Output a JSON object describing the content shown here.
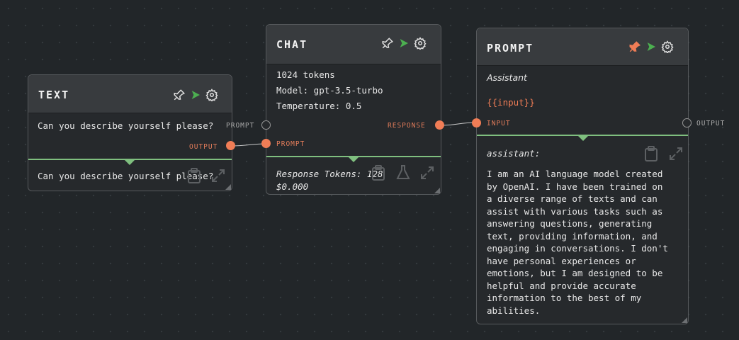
{
  "nodes": {
    "text": {
      "title": "TEXT",
      "content": "Can you describe yourself please?",
      "output_label": "OUTPUT",
      "result": "Can you describe yourself please?"
    },
    "chat": {
      "title": "CHAT",
      "tokens": "1024 tokens",
      "model": "Model: gpt-3.5-turbo",
      "temperature": "Temperature: 0.5",
      "in_prompt_label": "PROMPT",
      "response_label": "RESPONSE",
      "out_prompt_label": "PROMPT",
      "response_tokens": "Response Tokens: 128",
      "cost": "$0.000"
    },
    "prompt": {
      "title": "PROMPT",
      "role": "Assistant",
      "template": "{{input}}",
      "input_label": "INPUT",
      "output_label": "OUTPUT",
      "result_role": "assistant:",
      "result_lines": [
        "I am an AI language model created",
        "by OpenAI. I have been trained on",
        "a diverse range of texts and can",
        "assist with various tasks such as",
        "answering questions, generating",
        "text, providing information, and",
        "engaging in conversations. I don't",
        "have personal experiences or",
        "emotions, but I am designed to be",
        "helpful and provide accurate",
        "information to the best of my",
        "abilities."
      ]
    }
  },
  "colors": {
    "accent_port": "#f07d56",
    "divider": "#7fbf7f",
    "play": "#4caf50",
    "pin_active": "#f07d56"
  }
}
